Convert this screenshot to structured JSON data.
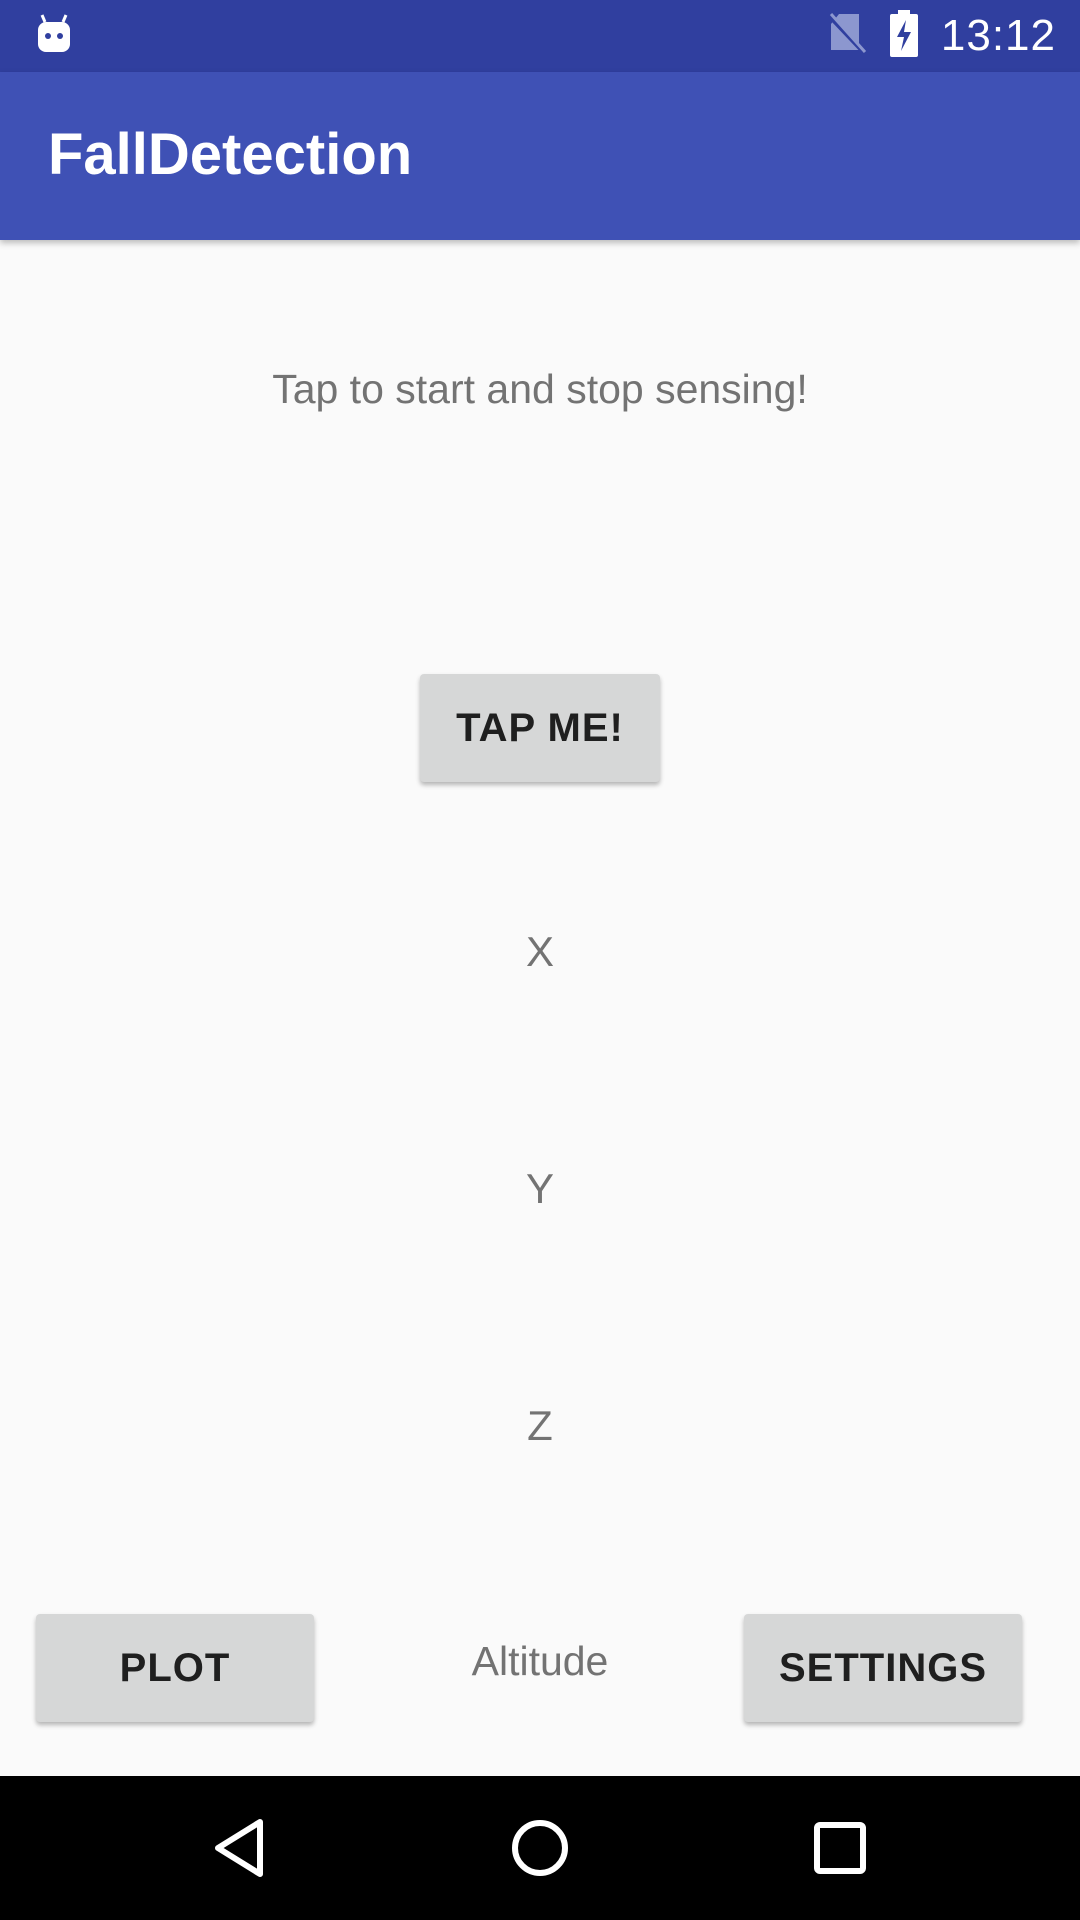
{
  "status_bar": {
    "time": "13:12",
    "icons": [
      "android-notification-icon",
      "no-sim-icon",
      "battery-charging-icon"
    ]
  },
  "app_bar": {
    "title": "FallDetection"
  },
  "main": {
    "instruction": "Tap to start and stop sensing!",
    "tap_button_label": "TAP ME!",
    "x_label": "X",
    "y_label": "Y",
    "z_label": "Z",
    "altitude_label": "Altitude",
    "plot_button_label": "PLOT",
    "settings_button_label": "SETTINGS"
  },
  "nav_bar": {
    "icons": [
      "back-icon",
      "home-icon",
      "recents-icon"
    ]
  },
  "colors": {
    "status_bar": "#303f9f",
    "app_bar": "#3f51b5",
    "background": "#fafafa",
    "button": "#d6d7d7",
    "secondary_text": "#737373"
  }
}
